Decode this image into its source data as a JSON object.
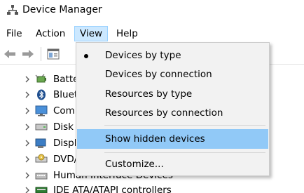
{
  "window": {
    "title": "Device Manager",
    "icon": "device-manager-icon"
  },
  "menubar": {
    "items": [
      {
        "label": "File"
      },
      {
        "label": "Action"
      },
      {
        "label": "View"
      },
      {
        "label": "Help"
      }
    ],
    "active": "View"
  },
  "toolbar": {
    "buttons": [
      "back-arrow-icon",
      "forward-arrow-icon",
      "properties-icon"
    ]
  },
  "tree": {
    "items": [
      {
        "label": "Batteries",
        "icon": "battery-icon"
      },
      {
        "label": "Bluetooth",
        "icon": "bluetooth-icon"
      },
      {
        "label": "Computer",
        "icon": "computer-icon"
      },
      {
        "label": "Disk drives",
        "icon": "disk-drive-icon"
      },
      {
        "label": "Display adapters",
        "icon": "display-adapter-icon"
      },
      {
        "label": "DVD/CD-ROM drives",
        "icon": "dvd-drive-icon"
      },
      {
        "label": "Human Interface Devices",
        "icon": "hid-icon"
      },
      {
        "label": "IDE ATA/ATAPI controllers",
        "icon": "ide-controller-icon"
      }
    ]
  },
  "view_menu": {
    "items": [
      {
        "label": "Devices by type",
        "checked": true
      },
      {
        "label": "Devices by connection",
        "checked": false
      },
      {
        "label": "Resources by type",
        "checked": false
      },
      {
        "label": "Resources by connection",
        "checked": false
      },
      {
        "label": "Show hidden devices",
        "checked": false,
        "highlighted": true
      },
      {
        "label": "Customize...",
        "checked": false
      }
    ]
  },
  "colors": {
    "menu_active_bg": "#cce8ff",
    "dropdown_bg": "#f2f2f2",
    "dropdown_highlight": "#91c9f7"
  }
}
